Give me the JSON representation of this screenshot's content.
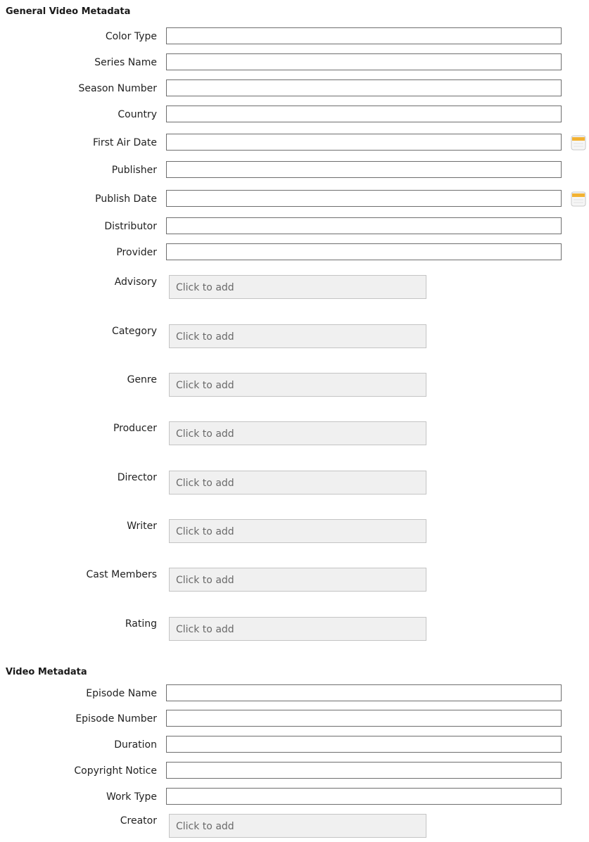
{
  "general": {
    "title": "General Video Metadata",
    "text_fields": [
      {
        "label": "Color Type",
        "value": ""
      },
      {
        "label": "Series Name",
        "value": ""
      },
      {
        "label": "Season Number",
        "value": ""
      },
      {
        "label": "Country",
        "value": ""
      },
      {
        "label": "First Air Date",
        "value": ""
      },
      {
        "label": "Publisher",
        "value": ""
      },
      {
        "label": "Publish Date",
        "value": ""
      },
      {
        "label": "Distributor",
        "value": ""
      },
      {
        "label": "Provider",
        "value": ""
      }
    ],
    "tag_fields": [
      {
        "label": "Advisory",
        "placeholder": "Click to add"
      },
      {
        "label": "Category",
        "placeholder": "Click to add"
      },
      {
        "label": "Genre",
        "placeholder": "Click to add"
      },
      {
        "label": "Producer",
        "placeholder": "Click to add"
      },
      {
        "label": "Director",
        "placeholder": "Click to add"
      },
      {
        "label": "Writer",
        "placeholder": "Click to add"
      },
      {
        "label": "Cast Members",
        "placeholder": "Click to add"
      },
      {
        "label": "Rating",
        "placeholder": "Click to add"
      }
    ]
  },
  "video": {
    "title": "Video Metadata",
    "text_fields": [
      {
        "label": "Episode Name",
        "value": ""
      },
      {
        "label": "Episode Number",
        "value": ""
      },
      {
        "label": "Duration",
        "value": ""
      },
      {
        "label": "Copyright Notice",
        "value": ""
      },
      {
        "label": "Work Type",
        "value": ""
      }
    ],
    "tag_fields": [
      {
        "label": "Creator",
        "placeholder": "Click to add"
      }
    ]
  },
  "icons": {
    "calendar": "calendar-icon"
  },
  "colors": {
    "input_border": "#6e6e6e",
    "tag_box_background": "#f0f0f0",
    "tag_box_border": "#c4c4c4",
    "calendar_accent": "#f2b233"
  }
}
